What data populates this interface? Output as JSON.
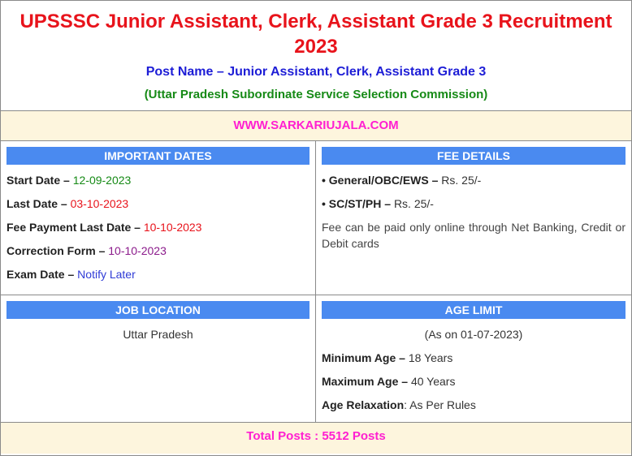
{
  "header": {
    "title": "UPSSSC Junior Assistant, Clerk, Assistant Grade 3 Recruitment 2023",
    "post_name": "Post Name – Junior Assistant, Clerk, Assistant Grade 3",
    "commission": "(Uttar Pradesh Subordinate Service Selection Commission)"
  },
  "website": "WWW.SARKARIUJALA.COM",
  "important_dates": {
    "heading": "IMPORTANT DATES",
    "items": [
      {
        "label": "Start Date –",
        "value": "12-09-2023"
      },
      {
        "label": "Last Date –",
        "value": "03-10-2023"
      },
      {
        "label": "Fee Payment Last Date –",
        "value": "10-10-2023"
      },
      {
        "label": "Correction Form –",
        "value": "10-10-2023"
      },
      {
        "label": "Exam Date –",
        "value": "Notify Later"
      }
    ]
  },
  "fee_details": {
    "heading": "FEE DETAILS",
    "items": [
      {
        "label": "• General/OBC/EWS –",
        "value": "Rs. 25/-"
      },
      {
        "label": "• SC/ST/PH –",
        "value": "Rs. 25/-"
      }
    ],
    "note": "Fee can be paid only online through Net Banking, Credit or Debit cards"
  },
  "job_location": {
    "heading": "JOB LOCATION",
    "value": "Uttar Pradesh"
  },
  "age_limit": {
    "heading": "AGE LIMIT",
    "as_on": "(As on 01-07-2023)",
    "items": [
      {
        "label": "Minimum Age –",
        "value": "18 Years"
      },
      {
        "label": "Maximum Age –",
        "value": "40 Years"
      },
      {
        "label": "Age Relaxation",
        "value": ": As Per Rules"
      }
    ]
  },
  "total_posts": "Total Posts : 5512 Posts"
}
